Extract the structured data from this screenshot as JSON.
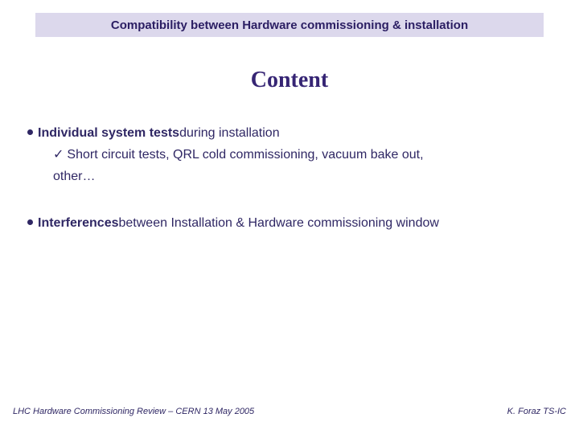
{
  "title": "Compatibility between Hardware commissioning & installation",
  "heading": "Content",
  "bullet1": {
    "bold": "Individual system tests",
    "rest": " during installation"
  },
  "sub1": {
    "check": "✓",
    "text": "Short circuit tests, QRL cold commissioning, vacuum bake out,",
    "cont": "other…"
  },
  "bullet2": {
    "bold": "Interferences",
    "rest": " between Installation & Hardware commissioning window"
  },
  "footer": {
    "left": "LHC Hardware Commissioning Review – CERN 13 May 2005",
    "right": "K. Foraz TS-IC"
  }
}
